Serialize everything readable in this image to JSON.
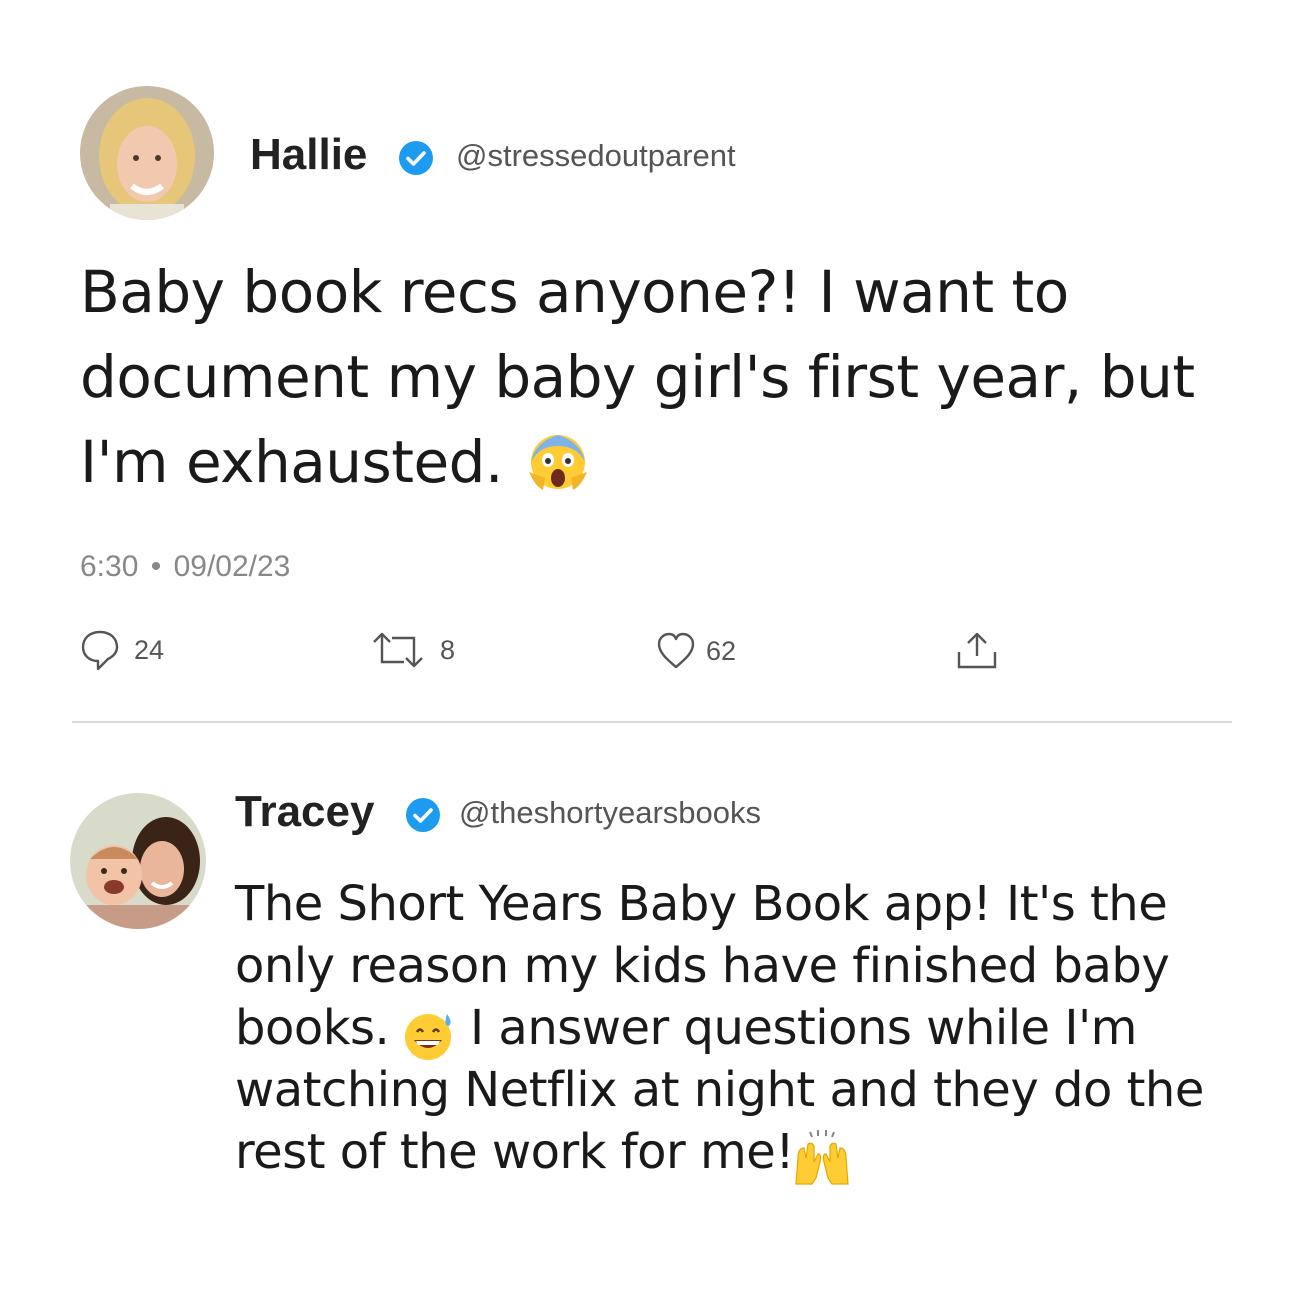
{
  "tweet": {
    "author": {
      "name": "Hallie",
      "handle": "@stressedoutparent"
    },
    "text_lines": [
      "Baby book recs anyone?! I want to",
      "document my baby girl's first year, but",
      "I'm exhausted."
    ],
    "emoji": "screaming-face-emoji",
    "time": "6:30",
    "separator": "•",
    "date": "09/02/23",
    "actions": {
      "replies": "24",
      "retweets": "8",
      "likes": "62"
    }
  },
  "reply": {
    "author": {
      "name": "Tracey",
      "handle": "@theshortyearsbooks"
    },
    "text_lines": [
      "The Short Years Baby Book app! It's the",
      "only reason my kids have finished baby",
      "books.",
      "I answer questions while I'm",
      "watching Netflix at night and they do the",
      "rest of the work for me!"
    ],
    "emojis": [
      "grinning-sweat-emoji",
      "raising-hands-emoji"
    ]
  },
  "colors": {
    "verified": "#1d9bf0",
    "divider": "#d9d9d9",
    "meta": "#888888",
    "emoji_yellow": "#ffcc33"
  }
}
